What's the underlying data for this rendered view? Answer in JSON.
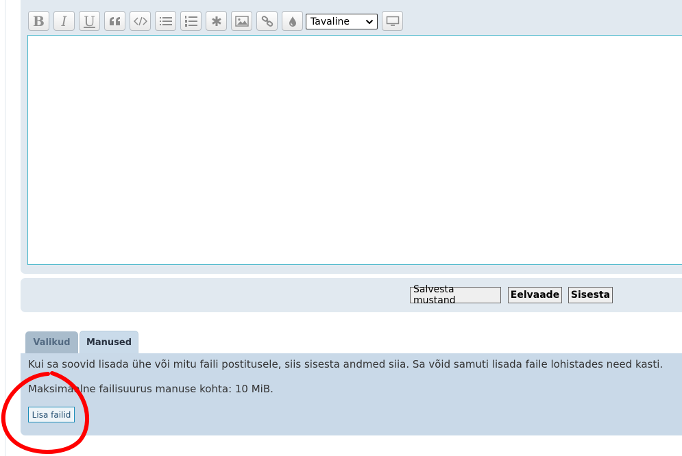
{
  "toolbar": {
    "buttons": [
      {
        "label": "B",
        "icon": "bold-icon"
      },
      {
        "label": "I",
        "icon": "italic-icon"
      },
      {
        "label": "U",
        "icon": "underline-icon"
      },
      {
        "icon": "quote-icon"
      },
      {
        "icon": "code-icon"
      },
      {
        "icon": "bullet-list-icon"
      },
      {
        "icon": "numbered-list-icon"
      },
      {
        "icon": "asterisk-icon"
      },
      {
        "icon": "image-icon"
      },
      {
        "icon": "link-icon"
      },
      {
        "icon": "color-drop-icon"
      }
    ],
    "font_size_select": {
      "value": "Tavaline"
    },
    "toggle_icon": "monitor-icon"
  },
  "editor": {
    "value": ""
  },
  "submit": {
    "save_draft": "Salvesta mustand",
    "preview": "Eelvaade",
    "submit": "Sisesta"
  },
  "tabs": {
    "options": "Valikud",
    "attachments": "Manused",
    "active": "Manused"
  },
  "attachments": {
    "intro": "Kui sa soovid lisada ühe või mitu faili postitusele, siis sisesta andmed siia. Sa võid samuti lisada faile lohistades need kasti.",
    "max_size": "Maksimaalne failisuurus manuse kohta: 10 MiB.",
    "add_files": "Lisa failid"
  },
  "colors": {
    "panel_bg": "#e1e9f0",
    "attach_bg": "#c9d9e8",
    "textarea_border": "#45b5c9",
    "annotation": "#ff0000"
  }
}
